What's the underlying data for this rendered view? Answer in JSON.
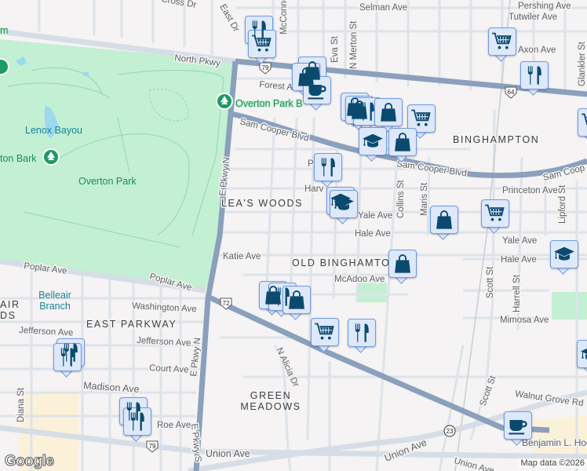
{
  "map": {
    "streets": [
      "North Pkwy",
      "Forest Ave",
      "Sam Cooper Blvd",
      "Sam Cooper Blvd",
      "Sam Coop",
      "E Pkwy N",
      "E Pkwy N",
      "E Pkwy S",
      "Poplar Ave",
      "Poplar Ave",
      "Katie Ave",
      "Washington Ave",
      "Jefferson Ave",
      "Jefferson Ave",
      "Court Ave",
      "Madison Ave",
      "Union Ave",
      "Union Ave",
      "Union Ave",
      "Selman Ave",
      "Pershing Ave",
      "Tutwiler Ave",
      "Eva St",
      "N Merton St",
      "Collins St",
      "Maris St",
      "Princeton Ave",
      "Yale Ave",
      "Yale Ave",
      "Hale Ave",
      "Hale Ave",
      "McAdoo Ave",
      "Scott St",
      "Scott St",
      "Harrell St",
      "Mimosa Ave",
      "Lipford St",
      "Glankler St",
      "Walnut Grove Rd",
      "N Alicia Dr",
      "Diana St",
      "Cross Dr",
      "East Dr",
      "McConnell",
      "Harv",
      "P",
      "Roe Ave",
      "Axon Ave"
    ],
    "neighborhoods": [
      "LEA'S WOODS",
      "BINGHAMPTON",
      "OLD BINGHAMTON",
      "EAST PARKWAY",
      "GREEN MEADOWS",
      "AIR",
      "DS"
    ],
    "parks": [
      "Overton Park",
      "Overton Park B",
      "Lenox Bayou",
      "Belleair Branch",
      "ton Bark",
      "m",
      "Benjamin L. Hooks Central Library"
    ],
    "highways": [
      "79",
      "64",
      "72",
      "79",
      "23"
    ],
    "google_logo": "Google",
    "attribution": "Map data ©2026"
  },
  "markers": [
    {
      "type": "restaurant"
    },
    {
      "type": "grocery"
    },
    {
      "type": "shopping"
    },
    {
      "type": "shopping"
    },
    {
      "type": "coffee"
    },
    {
      "type": "shopping"
    },
    {
      "type": "shopping"
    },
    {
      "type": "restaurant"
    },
    {
      "type": "shopping"
    },
    {
      "type": "grocery"
    },
    {
      "type": "school"
    },
    {
      "type": "shopping"
    },
    {
      "type": "restaurant"
    },
    {
      "type": "school"
    },
    {
      "type": "school"
    },
    {
      "type": "shopping"
    },
    {
      "type": "grocery"
    },
    {
      "type": "grocery"
    },
    {
      "type": "restaurant"
    },
    {
      "type": "grocery"
    },
    {
      "type": "shopping"
    },
    {
      "type": "school"
    },
    {
      "type": "school"
    },
    {
      "type": "shopping"
    },
    {
      "type": "restaurant"
    },
    {
      "type": "shopping"
    },
    {
      "type": "grocery"
    },
    {
      "type": "restaurant"
    },
    {
      "type": "restaurant"
    },
    {
      "type": "restaurant"
    },
    {
      "type": "restaurant"
    },
    {
      "type": "restaurant"
    },
    {
      "type": "coffee"
    }
  ],
  "colors": {
    "marker_icon": "#0b4a6f",
    "park": "#c3efd3",
    "highway": "#8aa0bd",
    "road": "#dde3ea"
  }
}
